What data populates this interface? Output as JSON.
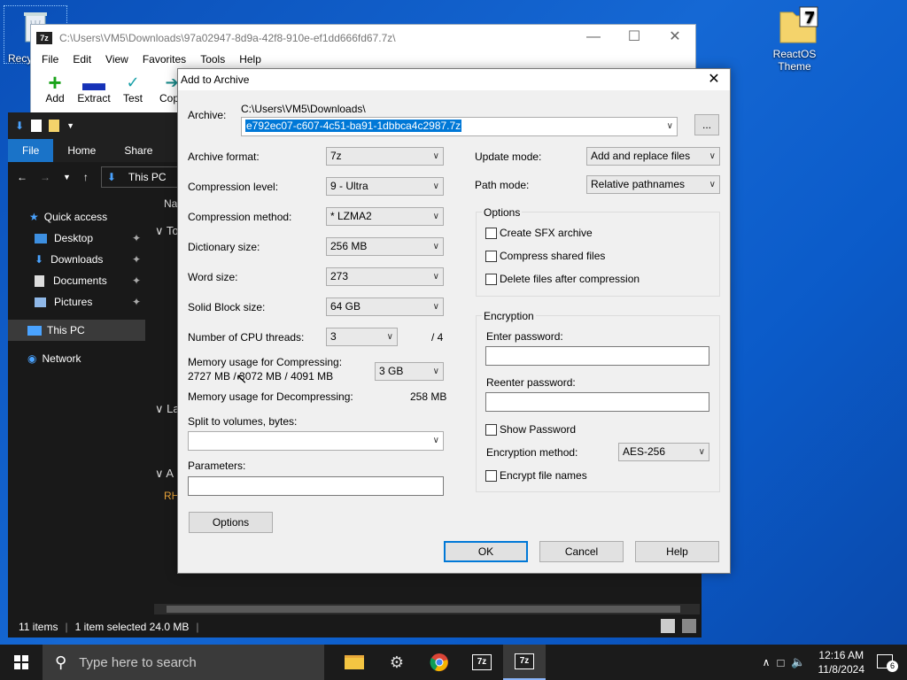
{
  "desktop": {
    "recycle_label": "Recy",
    "reactos_label_1": "ReactOS",
    "reactos_label_2": "Theme"
  },
  "filemanager": {
    "title": "C:\\Users\\VM5\\Downloads\\97a02947-8d9a-42f8-910e-ef1dd666fd67.7z\\",
    "menu": [
      "File",
      "Edit",
      "View",
      "Favorites",
      "Tools",
      "Help"
    ],
    "toolbar": [
      "Add",
      "Extract",
      "Test",
      "Copy"
    ]
  },
  "explorer": {
    "ribbon": [
      "File",
      "Home",
      "Share",
      "V"
    ],
    "address": "This PC",
    "nav": [
      "Quick access",
      "Desktop",
      "Downloads",
      "Documents",
      "Pictures",
      "This PC",
      "Network"
    ],
    "status_items": "11 items",
    "status_selected": "1 item selected  24.0 MB",
    "partial_col": "Na",
    "partial_1": "To",
    "partial_2": "La",
    "partial_3": "A",
    "partial_4": "RH"
  },
  "dialog": {
    "title": "Add to Archive",
    "archive_label": "Archive:",
    "archive_dir": "C:\\Users\\VM5\\Downloads\\",
    "archive_name": "e792ec07-c607-4c51-ba91-1dbbca4c2987.7z",
    "browse_label": "...",
    "archive_format_label": "Archive format:",
    "archive_format": "7z",
    "compression_level_label": "Compression level:",
    "compression_level": "9 - Ultra",
    "compression_method_label": "Compression method:",
    "compression_method": "* LZMA2",
    "dictionary_size_label": "Dictionary size:",
    "dictionary_size": "256 MB",
    "word_size_label": "Word size:",
    "word_size": "273",
    "solid_block_label": "Solid Block size:",
    "solid_block": "64 GB",
    "cpu_threads_label": "Number of CPU threads:",
    "cpu_threads": "3",
    "cpu_threads_total": "/ 4",
    "mem_compress_label": "Memory usage for Compressing:",
    "mem_compress_value": "2727 MB / 3072 MB / 4091 MB",
    "mem_limit": "3 GB",
    "mem_decompress_label": "Memory usage for Decompressing:",
    "mem_decompress_value": "258 MB",
    "split_label": "Split to volumes, bytes:",
    "split_value": "",
    "parameters_label": "Parameters:",
    "parameters_value": "",
    "options_button": "Options",
    "update_mode_label": "Update mode:",
    "update_mode": "Add and replace files",
    "path_mode_label": "Path mode:",
    "path_mode": "Relative pathnames",
    "options_group": "Options",
    "opt_sfx": "Create SFX archive",
    "opt_shared": "Compress shared files",
    "opt_delete": "Delete files after compression",
    "encryption_group": "Encryption",
    "enter_password_label": "Enter password:",
    "reenter_password_label": "Reenter password:",
    "show_password": "Show Password",
    "encryption_method_label": "Encryption method:",
    "encryption_method": "AES-256",
    "encrypt_names": "Encrypt file names",
    "ok": "OK",
    "cancel": "Cancel",
    "help": "Help"
  },
  "taskbar": {
    "search_placeholder": "Type here to search",
    "time": "12:16 AM",
    "date": "11/8/2024",
    "notif_count": "6"
  }
}
